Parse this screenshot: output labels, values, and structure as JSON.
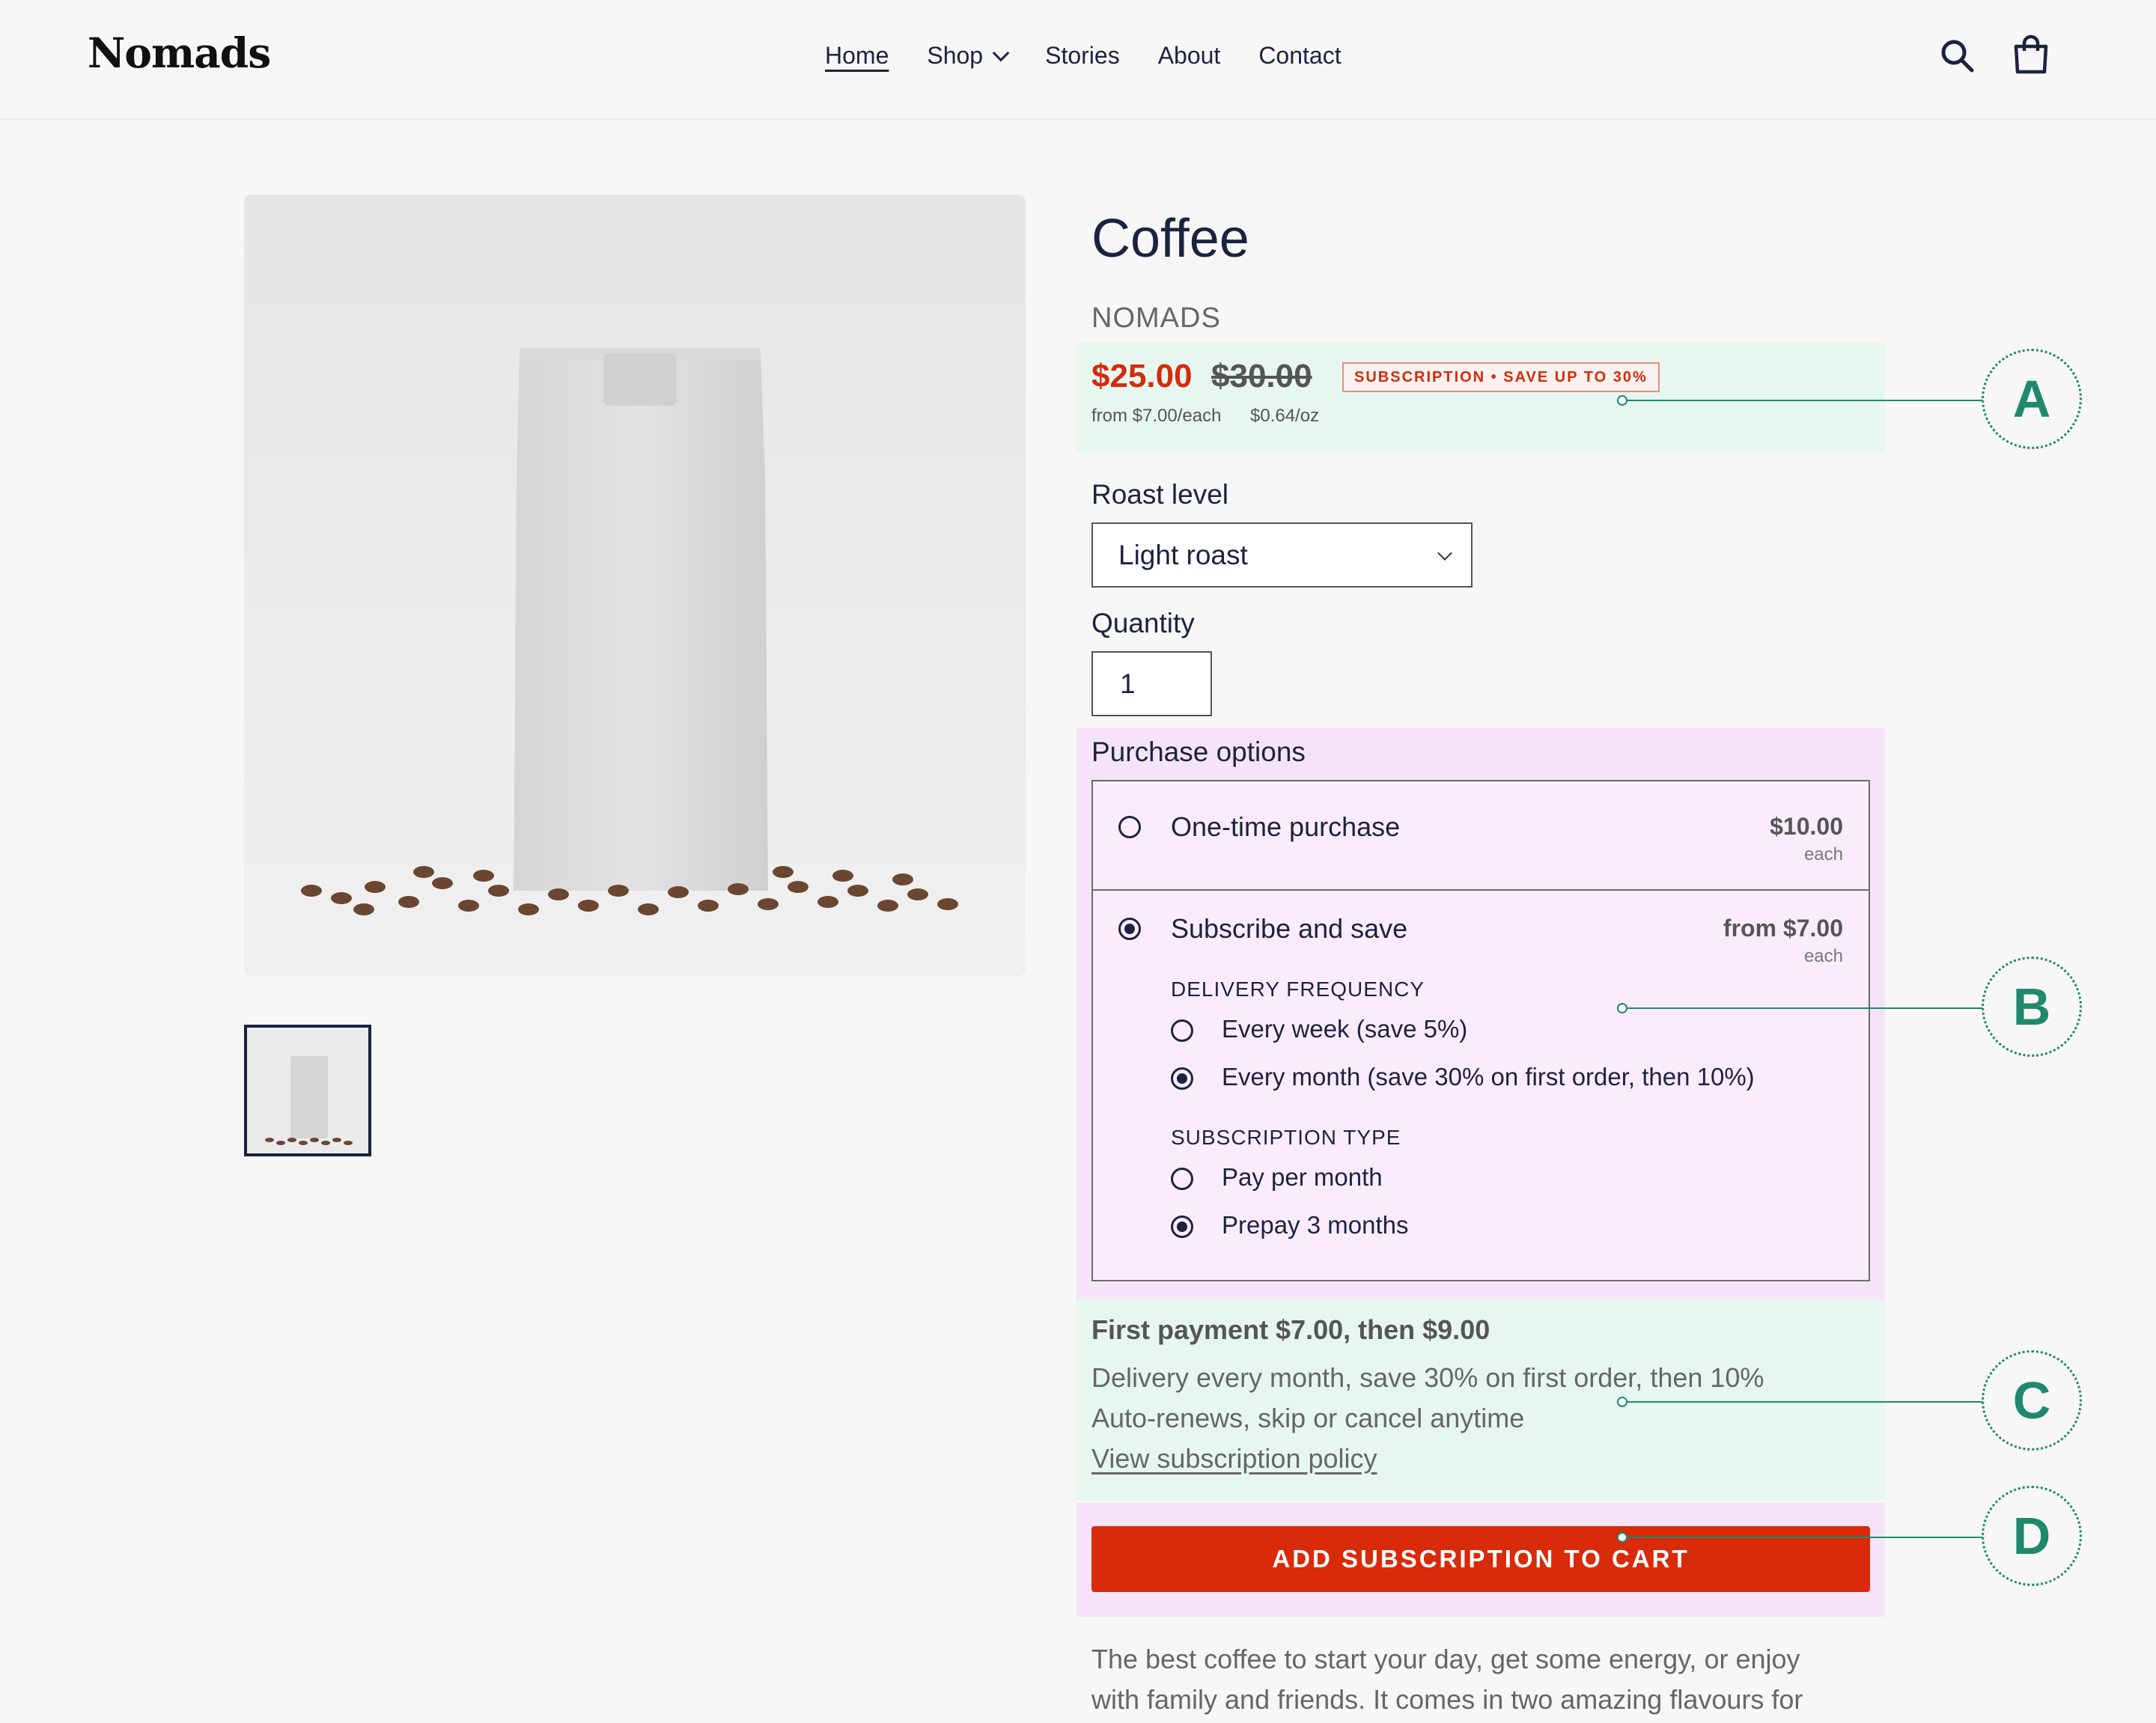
{
  "header": {
    "logo": "Nomads",
    "nav": [
      "Home",
      "Shop",
      "Stories",
      "About",
      "Contact"
    ],
    "active_nav": "Home",
    "icons": [
      "search-icon",
      "cart-icon"
    ]
  },
  "product": {
    "title": "Coffee",
    "vendor": "NOMADS",
    "price": "$25.00",
    "compare_price": "$30.00",
    "badge": "SUBSCRIPTION • SAVE UP TO 30%",
    "unit_from": "from $7.00/each",
    "unit_oz": "$0.64/oz",
    "roast_label": "Roast level",
    "roast_value": "Light roast",
    "quantity_label": "Quantity",
    "quantity_value": "1",
    "purchase_label": "Purchase options"
  },
  "options": {
    "one_time": {
      "label": "One-time purchase",
      "price": "$10.00",
      "each": "each",
      "selected": false
    },
    "subscribe": {
      "label": "Subscribe and save",
      "price": "from $7.00",
      "each": "each",
      "selected": true
    },
    "frequency_title": "DELIVERY FREQUENCY",
    "frequency": [
      {
        "label": "Every week (save 5%)",
        "selected": false
      },
      {
        "label": "Every month (save 30% on first order, then 10%)",
        "selected": true
      }
    ],
    "type_title": "SUBSCRIPTION TYPE",
    "types": [
      {
        "label": "Pay per month",
        "selected": false
      },
      {
        "label": "Prepay 3 months",
        "selected": true
      }
    ]
  },
  "summary": {
    "first_payment": "First payment $7.00, then $9.00",
    "delivery": "Delivery every month, save 30% on first order, then 10%",
    "renew": "Auto-renews, skip or cancel anytime",
    "policy_link": "View subscription policy"
  },
  "cta": "ADD SUBSCRIPTION TO CART",
  "description": [
    "The best coffee to start your day, get some energy, or enjoy",
    "with family and friends. It comes in two amazing flavours for"
  ],
  "callouts": [
    "A",
    "B",
    "C",
    "D"
  ],
  "colors": {
    "accent_red": "#d92a0a",
    "navy": "#1c2340",
    "zone_green": "#e6f7f0",
    "zone_pink": "#f5e4f7",
    "callout_green": "#1f8a6a"
  }
}
